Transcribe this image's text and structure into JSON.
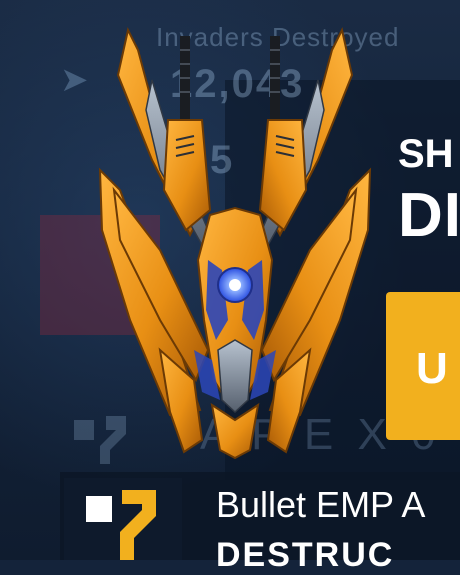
{
  "stats": {
    "label": "Invaders Destroyed",
    "value": "12,043",
    "value_secondary": "5"
  },
  "ship": {
    "heading": "SH",
    "name": "DI",
    "accent_color": "#f0a020",
    "core_color": "#3a6cff"
  },
  "upgrade": {
    "label": "U",
    "color": "#f2b01e"
  },
  "faded": {
    "text": "A P E X 0"
  },
  "weapon": {
    "name": "Bullet EMP A",
    "subtitle": "DESTRUC",
    "icon": "weapon-emp-icon",
    "icon_colors": [
      "#ffffff",
      "#f2b01e"
    ]
  }
}
